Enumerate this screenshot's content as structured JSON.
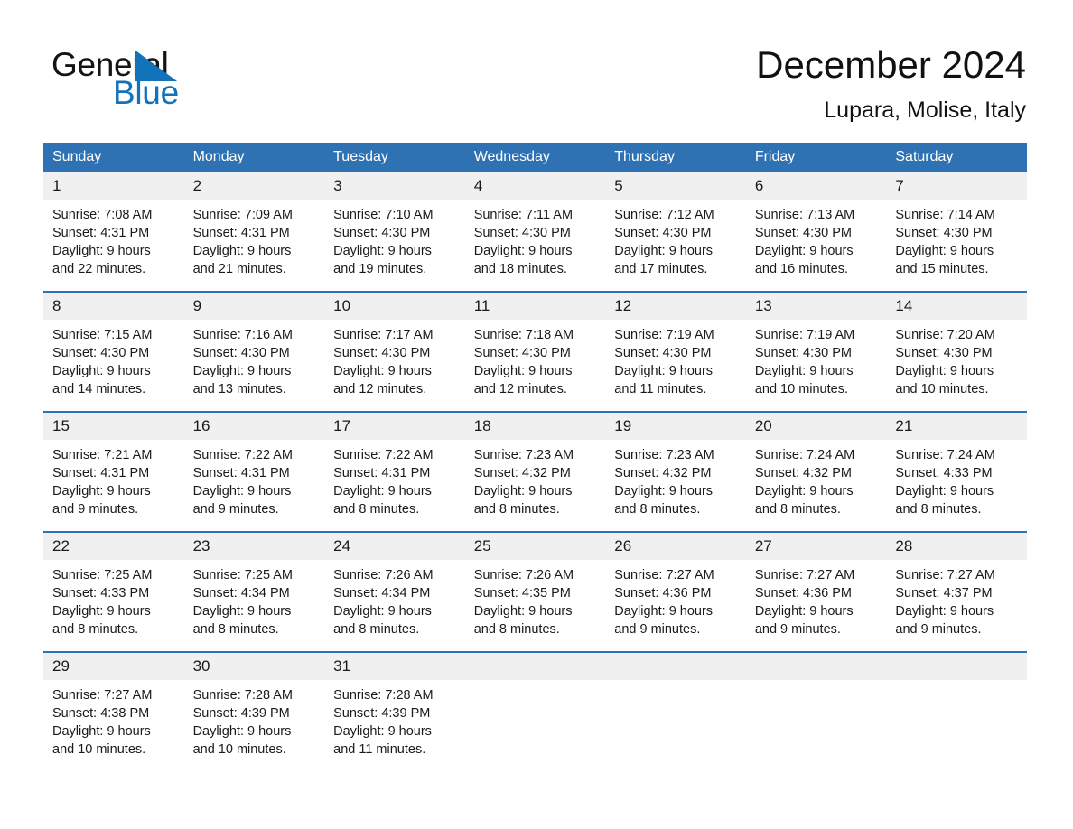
{
  "brand": {
    "name_part1": "General",
    "name_part2": "Blue",
    "logo_icon": "triangle-logo-icon",
    "accent_color": "#1273bb"
  },
  "header": {
    "title": "December 2024",
    "subtitle": "Lupara, Molise, Italy"
  },
  "theme": {
    "header_blue": "#2e72b4",
    "day_band_gray": "#f0f0f0",
    "text_color": "#1a1a1a"
  },
  "calendar": {
    "weekday_headers": [
      "Sunday",
      "Monday",
      "Tuesday",
      "Wednesday",
      "Thursday",
      "Friday",
      "Saturday"
    ],
    "weeks": [
      [
        {
          "day": "1",
          "sunrise": "Sunrise: 7:08 AM",
          "sunset": "Sunset: 4:31 PM",
          "daylight_line1": "Daylight: 9 hours",
          "daylight_line2": "and 22 minutes."
        },
        {
          "day": "2",
          "sunrise": "Sunrise: 7:09 AM",
          "sunset": "Sunset: 4:31 PM",
          "daylight_line1": "Daylight: 9 hours",
          "daylight_line2": "and 21 minutes."
        },
        {
          "day": "3",
          "sunrise": "Sunrise: 7:10 AM",
          "sunset": "Sunset: 4:30 PM",
          "daylight_line1": "Daylight: 9 hours",
          "daylight_line2": "and 19 minutes."
        },
        {
          "day": "4",
          "sunrise": "Sunrise: 7:11 AM",
          "sunset": "Sunset: 4:30 PM",
          "daylight_line1": "Daylight: 9 hours",
          "daylight_line2": "and 18 minutes."
        },
        {
          "day": "5",
          "sunrise": "Sunrise: 7:12 AM",
          "sunset": "Sunset: 4:30 PM",
          "daylight_line1": "Daylight: 9 hours",
          "daylight_line2": "and 17 minutes."
        },
        {
          "day": "6",
          "sunrise": "Sunrise: 7:13 AM",
          "sunset": "Sunset: 4:30 PM",
          "daylight_line1": "Daylight: 9 hours",
          "daylight_line2": "and 16 minutes."
        },
        {
          "day": "7",
          "sunrise": "Sunrise: 7:14 AM",
          "sunset": "Sunset: 4:30 PM",
          "daylight_line1": "Daylight: 9 hours",
          "daylight_line2": "and 15 minutes."
        }
      ],
      [
        {
          "day": "8",
          "sunrise": "Sunrise: 7:15 AM",
          "sunset": "Sunset: 4:30 PM",
          "daylight_line1": "Daylight: 9 hours",
          "daylight_line2": "and 14 minutes."
        },
        {
          "day": "9",
          "sunrise": "Sunrise: 7:16 AM",
          "sunset": "Sunset: 4:30 PM",
          "daylight_line1": "Daylight: 9 hours",
          "daylight_line2": "and 13 minutes."
        },
        {
          "day": "10",
          "sunrise": "Sunrise: 7:17 AM",
          "sunset": "Sunset: 4:30 PM",
          "daylight_line1": "Daylight: 9 hours",
          "daylight_line2": "and 12 minutes."
        },
        {
          "day": "11",
          "sunrise": "Sunrise: 7:18 AM",
          "sunset": "Sunset: 4:30 PM",
          "daylight_line1": "Daylight: 9 hours",
          "daylight_line2": "and 12 minutes."
        },
        {
          "day": "12",
          "sunrise": "Sunrise: 7:19 AM",
          "sunset": "Sunset: 4:30 PM",
          "daylight_line1": "Daylight: 9 hours",
          "daylight_line2": "and 11 minutes."
        },
        {
          "day": "13",
          "sunrise": "Sunrise: 7:19 AM",
          "sunset": "Sunset: 4:30 PM",
          "daylight_line1": "Daylight: 9 hours",
          "daylight_line2": "and 10 minutes."
        },
        {
          "day": "14",
          "sunrise": "Sunrise: 7:20 AM",
          "sunset": "Sunset: 4:30 PM",
          "daylight_line1": "Daylight: 9 hours",
          "daylight_line2": "and 10 minutes."
        }
      ],
      [
        {
          "day": "15",
          "sunrise": "Sunrise: 7:21 AM",
          "sunset": "Sunset: 4:31 PM",
          "daylight_line1": "Daylight: 9 hours",
          "daylight_line2": "and 9 minutes."
        },
        {
          "day": "16",
          "sunrise": "Sunrise: 7:22 AM",
          "sunset": "Sunset: 4:31 PM",
          "daylight_line1": "Daylight: 9 hours",
          "daylight_line2": "and 9 minutes."
        },
        {
          "day": "17",
          "sunrise": "Sunrise: 7:22 AM",
          "sunset": "Sunset: 4:31 PM",
          "daylight_line1": "Daylight: 9 hours",
          "daylight_line2": "and 8 minutes."
        },
        {
          "day": "18",
          "sunrise": "Sunrise: 7:23 AM",
          "sunset": "Sunset: 4:32 PM",
          "daylight_line1": "Daylight: 9 hours",
          "daylight_line2": "and 8 minutes."
        },
        {
          "day": "19",
          "sunrise": "Sunrise: 7:23 AM",
          "sunset": "Sunset: 4:32 PM",
          "daylight_line1": "Daylight: 9 hours",
          "daylight_line2": "and 8 minutes."
        },
        {
          "day": "20",
          "sunrise": "Sunrise: 7:24 AM",
          "sunset": "Sunset: 4:32 PM",
          "daylight_line1": "Daylight: 9 hours",
          "daylight_line2": "and 8 minutes."
        },
        {
          "day": "21",
          "sunrise": "Sunrise: 7:24 AM",
          "sunset": "Sunset: 4:33 PM",
          "daylight_line1": "Daylight: 9 hours",
          "daylight_line2": "and 8 minutes."
        }
      ],
      [
        {
          "day": "22",
          "sunrise": "Sunrise: 7:25 AM",
          "sunset": "Sunset: 4:33 PM",
          "daylight_line1": "Daylight: 9 hours",
          "daylight_line2": "and 8 minutes."
        },
        {
          "day": "23",
          "sunrise": "Sunrise: 7:25 AM",
          "sunset": "Sunset: 4:34 PM",
          "daylight_line1": "Daylight: 9 hours",
          "daylight_line2": "and 8 minutes."
        },
        {
          "day": "24",
          "sunrise": "Sunrise: 7:26 AM",
          "sunset": "Sunset: 4:34 PM",
          "daylight_line1": "Daylight: 9 hours",
          "daylight_line2": "and 8 minutes."
        },
        {
          "day": "25",
          "sunrise": "Sunrise: 7:26 AM",
          "sunset": "Sunset: 4:35 PM",
          "daylight_line1": "Daylight: 9 hours",
          "daylight_line2": "and 8 minutes."
        },
        {
          "day": "26",
          "sunrise": "Sunrise: 7:27 AM",
          "sunset": "Sunset: 4:36 PM",
          "daylight_line1": "Daylight: 9 hours",
          "daylight_line2": "and 9 minutes."
        },
        {
          "day": "27",
          "sunrise": "Sunrise: 7:27 AM",
          "sunset": "Sunset: 4:36 PM",
          "daylight_line1": "Daylight: 9 hours",
          "daylight_line2": "and 9 minutes."
        },
        {
          "day": "28",
          "sunrise": "Sunrise: 7:27 AM",
          "sunset": "Sunset: 4:37 PM",
          "daylight_line1": "Daylight: 9 hours",
          "daylight_line2": "and 9 minutes."
        }
      ],
      [
        {
          "day": "29",
          "sunrise": "Sunrise: 7:27 AM",
          "sunset": "Sunset: 4:38 PM",
          "daylight_line1": "Daylight: 9 hours",
          "daylight_line2": "and 10 minutes."
        },
        {
          "day": "30",
          "sunrise": "Sunrise: 7:28 AM",
          "sunset": "Sunset: 4:39 PM",
          "daylight_line1": "Daylight: 9 hours",
          "daylight_line2": "and 10 minutes."
        },
        {
          "day": "31",
          "sunrise": "Sunrise: 7:28 AM",
          "sunset": "Sunset: 4:39 PM",
          "daylight_line1": "Daylight: 9 hours",
          "daylight_line2": "and 11 minutes."
        },
        {
          "day": "",
          "sunrise": "",
          "sunset": "",
          "daylight_line1": "",
          "daylight_line2": ""
        },
        {
          "day": "",
          "sunrise": "",
          "sunset": "",
          "daylight_line1": "",
          "daylight_line2": ""
        },
        {
          "day": "",
          "sunrise": "",
          "sunset": "",
          "daylight_line1": "",
          "daylight_line2": ""
        },
        {
          "day": "",
          "sunrise": "",
          "sunset": "",
          "daylight_line1": "",
          "daylight_line2": ""
        }
      ]
    ]
  }
}
